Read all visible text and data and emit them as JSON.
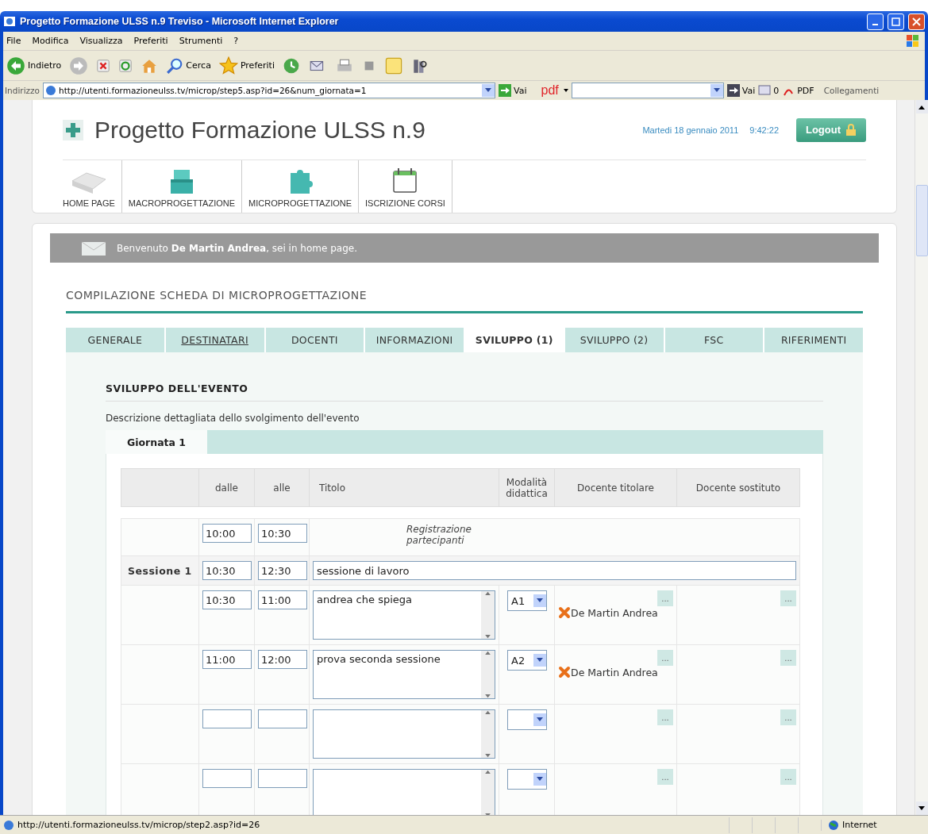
{
  "window": {
    "title": "Progetto Formazione ULSS n.9 Treviso - Microsoft Internet Explorer"
  },
  "menu": [
    "File",
    "Modifica",
    "Visualizza",
    "Preferiti",
    "Strumenti",
    "?"
  ],
  "toolbar": [
    {
      "kind": "back",
      "label": "Indietro"
    },
    {
      "kind": "forward"
    },
    {
      "kind": "stop"
    },
    {
      "kind": "refresh"
    },
    {
      "kind": "home"
    },
    {
      "kind": "search",
      "label": "Cerca"
    },
    {
      "kind": "favorites",
      "label": "Preferiti"
    },
    {
      "kind": "history"
    },
    {
      "kind": "mail"
    },
    {
      "kind": "print"
    },
    {
      "kind": "edit"
    },
    {
      "kind": "note"
    },
    {
      "kind": "research"
    }
  ],
  "address_bar": {
    "label": "Indirizzo",
    "url": "http://utenti.formazioneulss.tv/microp/step5.asp?id=26&num_giornata=1",
    "go": "Vai",
    "pdf_label": "pdf",
    "go2": "Vai",
    "count": "0",
    "pdf_button": "PDF",
    "links": "Collegamenti"
  },
  "page": {
    "site_title": "Progetto Formazione ULSS n.9",
    "date": "Martedi 18 gennaio 2011",
    "time": "9:42:22",
    "logout": "Logout",
    "nav": [
      {
        "kind": "home",
        "label": "HOME PAGE"
      },
      {
        "kind": "macro",
        "label": "MACROPROGETTAZIONE"
      },
      {
        "kind": "micro",
        "label": "MICROPROGETTAZIONE"
      },
      {
        "kind": "calendar",
        "label": "ISCRIZIONE CORSI"
      }
    ],
    "welcome": "Benvenuto **De Martin Andrea**, sei in home page.",
    "section_title": "COMPILAZIONE SCHEDA DI MICROPROGETTAZIONE",
    "tabs": [
      {
        "label": "GENERALE",
        "selected": false,
        "hovered": false
      },
      {
        "label": "DESTINATARI",
        "selected": false,
        "hovered": true
      },
      {
        "label": "DOCENTI",
        "selected": false,
        "hovered": false
      },
      {
        "label": "INFORMAZIONI",
        "selected": false,
        "hovered": false
      },
      {
        "label": "SVILUPPO (1)",
        "selected": true,
        "hovered": false
      },
      {
        "label": "SVILUPPO (2)",
        "selected": false,
        "hovered": false
      },
      {
        "label": "FSC",
        "selected": false,
        "hovered": false
      },
      {
        "label": "RIFERIMENTI",
        "selected": false,
        "hovered": false
      }
    ],
    "panel": {
      "heading": "SVILUPPO DELL'EVENTO",
      "description": "Descrizione dettagliata dello svolgimento dell'evento",
      "day_tabs": [
        {
          "label": "Giornata 1",
          "selected": true
        }
      ],
      "table": {
        "columns": [
          "dalle",
          "alle",
          "Titolo",
          "Modalità didattica",
          "Docente titolare",
          "Docente sostituto"
        ],
        "rows": [
          {
            "kind": "registration",
            "from": "10:00",
            "to": "10:30",
            "title": "Registrazione partecipanti"
          },
          {
            "kind": "session",
            "label": "Sessione 1",
            "from": "10:30",
            "to": "12:30",
            "title": "sessione di lavoro"
          },
          {
            "kind": "activity",
            "from": "10:30",
            "to": "11:00",
            "title": "andrea che spiega",
            "mode": "A1",
            "teacher": "De Martin Andrea",
            "teacher_button": "...",
            "substitute_button": "..."
          },
          {
            "kind": "activity",
            "from": "11:00",
            "to": "12:00",
            "title": "prova seconda sessione",
            "mode": "A2",
            "teacher": "De Martin Andrea",
            "teacher_button": "...",
            "substitute_button": "..."
          },
          {
            "kind": "activity",
            "teacher_button": "...",
            "substitute_button": "..."
          },
          {
            "kind": "activity",
            "teacher_button": "...",
            "substitute_button": "..."
          }
        ]
      }
    }
  },
  "status_bar": {
    "url": "http://utenti.formazioneulss.tv/microp/step2.asp?id=26",
    "zone": "Internet"
  }
}
